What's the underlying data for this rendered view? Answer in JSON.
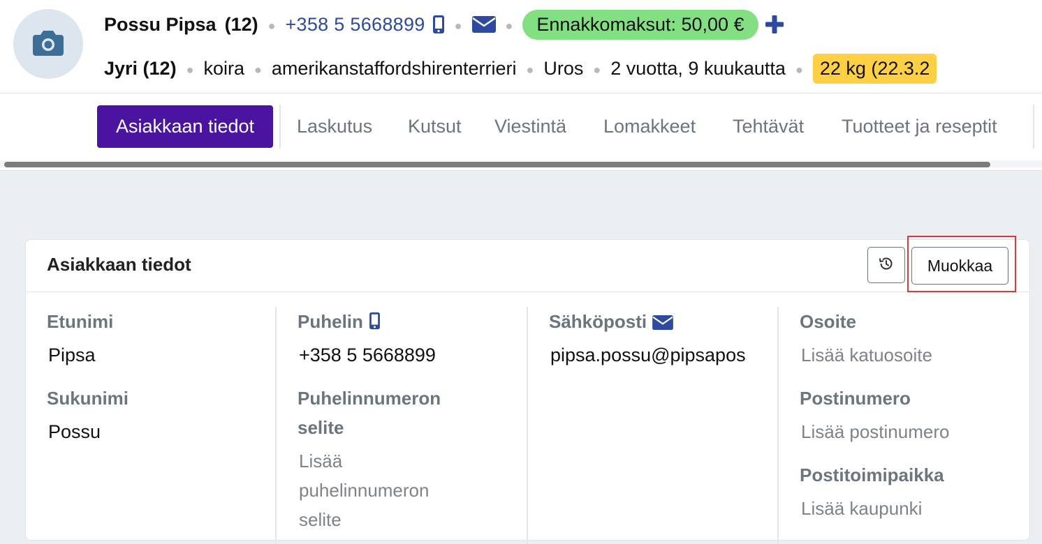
{
  "header": {
    "owner_name": "Possu Pipsa",
    "owner_count": "(12)",
    "phone": "+358 5 5668899",
    "prepayment": "Ennakkomaksut: 50,00 €",
    "pet_name": "Jyri (12)",
    "pet_species": "koira",
    "pet_breed": "amerikanstaffordshirenterrieri",
    "pet_sex": "Uros",
    "pet_age": "2 vuotta, 9 kuukautta",
    "pet_weight": "22 kg (22.3.2"
  },
  "nav": {
    "tabs": [
      {
        "label": "Asiakkaan tiedot",
        "active": true
      },
      {
        "label": "Laskutus"
      },
      {
        "label": "Kutsut"
      },
      {
        "label": "Viestintä"
      },
      {
        "label": "Lomakkeet"
      },
      {
        "label": "Tehtävät"
      },
      {
        "label": "Tuotteet ja reseptit"
      }
    ]
  },
  "card": {
    "title": "Asiakkaan tiedot",
    "edit_label": "Muokkaa",
    "columns": [
      {
        "fields": [
          {
            "label": "Etunimi",
            "value": "Pipsa"
          },
          {
            "label": "Sukunimi",
            "value": "Possu"
          }
        ]
      },
      {
        "fields": [
          {
            "label": "Puhelin",
            "value": "+358 5 5668899"
          },
          {
            "label": "Puhelinnumeron selite",
            "placeholder": "Lisää puhelinnumeron selite"
          }
        ]
      },
      {
        "fields": [
          {
            "label": "Sähköposti",
            "value": "pipsa.possu@pipsapossu.fi"
          }
        ]
      },
      {
        "fields": [
          {
            "label": "Osoite",
            "placeholder": "Lisää katuosoite"
          },
          {
            "label": "Postinumero",
            "placeholder": "Lisää postinumero"
          },
          {
            "label": "Postitoimipaikka",
            "placeholder": "Lisää kaupunki"
          }
        ]
      }
    ]
  },
  "colors": {
    "brand_purple": "#4a14a0",
    "link_blue": "#2d4aa0",
    "prepay_green": "#83e082",
    "weight_yellow": "#ffd044",
    "highlight_red": "#d63b3b"
  }
}
